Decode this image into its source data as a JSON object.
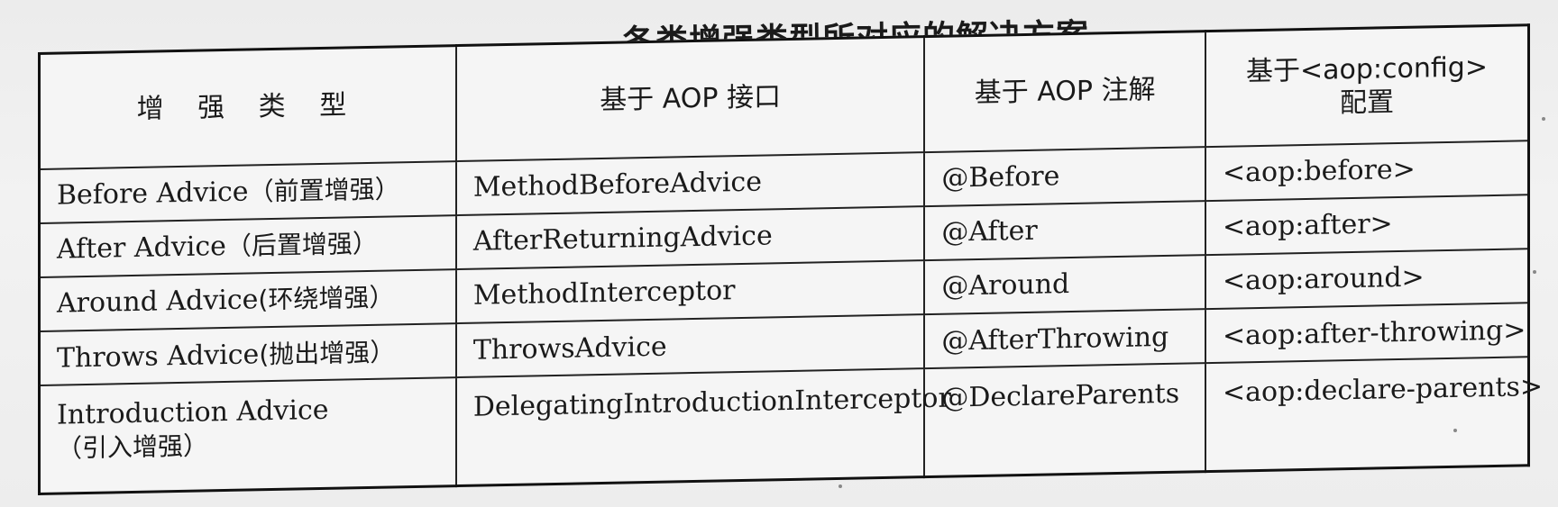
{
  "caption": "各类增强类型所对应的解决方案",
  "top_fragment": "",
  "table": {
    "headers": {
      "type": "增 强 类 型",
      "aop_interface": "基于 AOP 接口",
      "aop_annotation": "基于 AOP 注解",
      "aop_config_line1": "基于<aop:config>",
      "aop_config_line2": "配置"
    },
    "rows": [
      {
        "type_en": "Before Advice",
        "type_cn": "（前置增强）",
        "interface": "MethodBeforeAdvice",
        "annotation": "@Before",
        "config": "<aop:before>"
      },
      {
        "type_en": "After Advice",
        "type_cn": "（后置增强）",
        "interface": "AfterReturningAdvice",
        "annotation": "@After",
        "config": "<aop:after>"
      },
      {
        "type_en": "Around Advice",
        "type_cn": "(环绕增强）",
        "interface": "MethodInterceptor",
        "annotation": "@Around",
        "config": "<aop:around>"
      },
      {
        "type_en": "Throws Advice",
        "type_cn": "(抛出增强）",
        "interface": "ThrowsAdvice",
        "annotation": "@AfterThrowing",
        "config": "<aop:after-throwing>"
      },
      {
        "type_en": "Introduction Advice",
        "type_cn": "（引入增强）",
        "interface": "DelegatingIntroductionInterceptor",
        "annotation": "@DeclareParents",
        "config": "<aop:declare-parents>"
      }
    ]
  }
}
